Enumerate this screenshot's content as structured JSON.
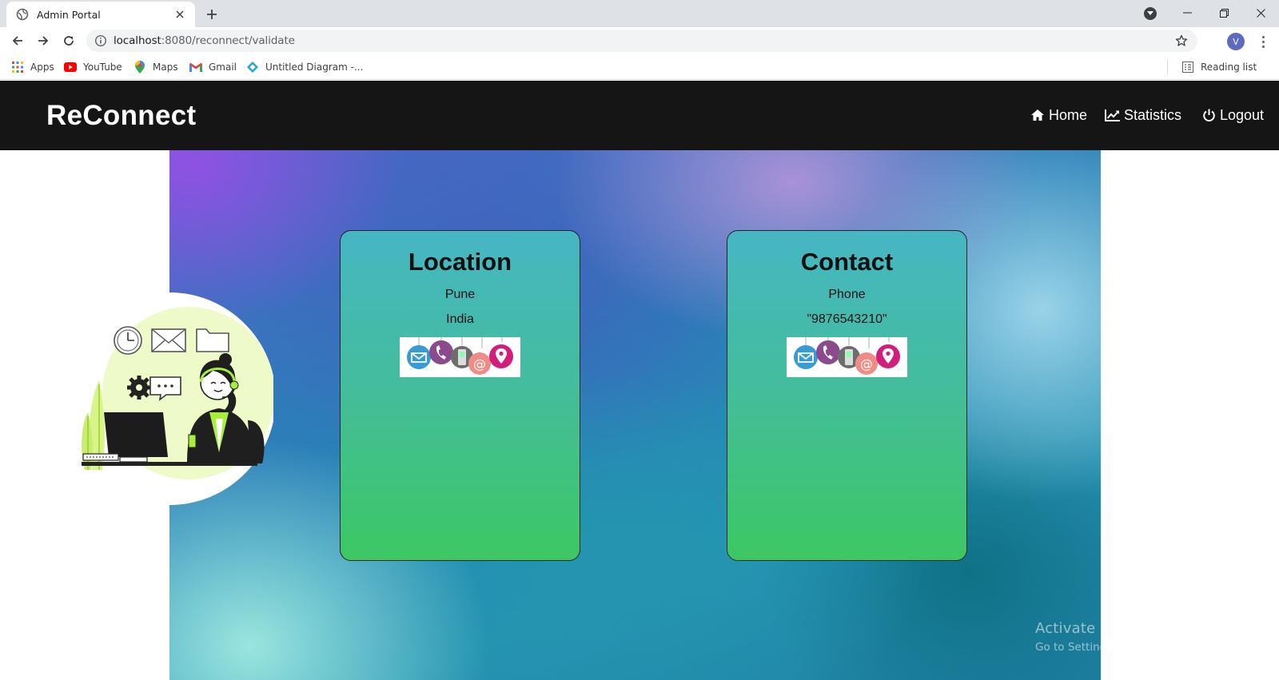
{
  "browser": {
    "tab_title": "Admin Portal",
    "url_host": "localhost",
    "url_path": ":8080/reconnect/validate",
    "profile_initial": "V",
    "bookmarks": [
      {
        "label": "Apps",
        "icon": "apps-grid-icon"
      },
      {
        "label": "YouTube",
        "icon": "youtube-icon"
      },
      {
        "label": "Maps",
        "icon": "maps-pin-icon"
      },
      {
        "label": "Gmail",
        "icon": "gmail-icon"
      },
      {
        "label": "Untitled Diagram -...",
        "icon": "drawio-icon"
      }
    ],
    "reading_list": "Reading list"
  },
  "app": {
    "brand": "ReConnect",
    "nav": [
      {
        "label": "Home",
        "icon": "home-icon"
      },
      {
        "label": "Statistics",
        "icon": "line-chart-icon"
      },
      {
        "label": "Logout",
        "icon": "power-icon"
      }
    ]
  },
  "cards": {
    "location": {
      "title": "Location",
      "line1": "Pune",
      "line2": "India"
    },
    "contact": {
      "title": "Contact",
      "line1": "Phone",
      "line2": "\"9876543210\""
    }
  },
  "watermark": {
    "title": "Activate Windows",
    "subtitle": "Go to Settings to activate Windows."
  },
  "colors": {
    "navbar_bg": "#151515",
    "card_top": "#46b6c4",
    "card_bottom": "#3dc764",
    "tabstrip_bg": "#dee1e6"
  }
}
